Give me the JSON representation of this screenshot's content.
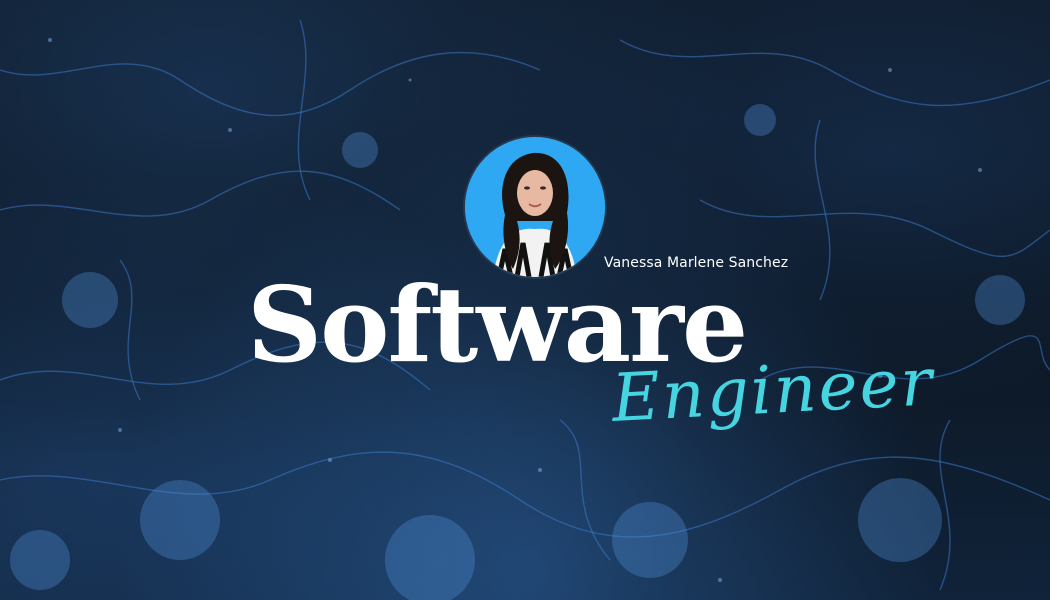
{
  "banner": {
    "person_name": "Vanessa Marlene Sanchez",
    "headline": "Software",
    "subheadline": "Engineer",
    "colors": {
      "background": "#0c1622",
      "texture": "#3b78c4",
      "headline": "#ffffff",
      "subheadline": "#45d4e0",
      "avatar_background": "#2ea8f2"
    },
    "avatar": {
      "icon": "profile-photo"
    }
  }
}
